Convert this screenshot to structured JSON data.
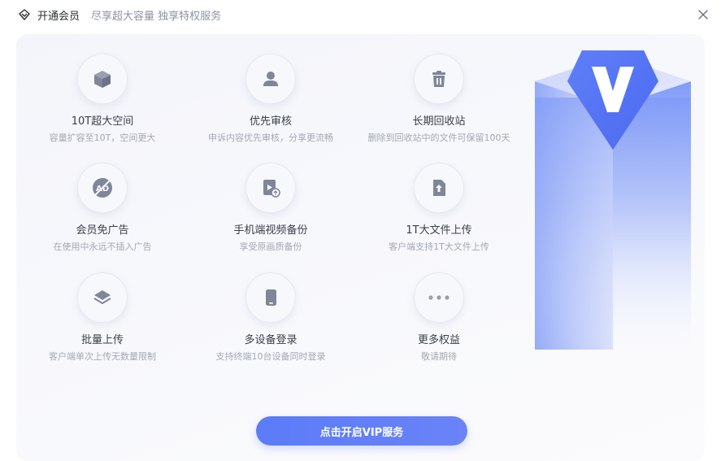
{
  "header": {
    "title": "开通会员",
    "subtitle": "尽享超大容量 独享特权服务"
  },
  "features": [
    {
      "title": "10T超大空间",
      "desc": "容量扩容至10T，空间更大",
      "icon": "cube-icon"
    },
    {
      "title": "优先审核",
      "desc": "申诉内容优先审核，分享更流畅",
      "icon": "user-icon"
    },
    {
      "title": "长期回收站",
      "desc": "删除到回收站中的文件可保留100天",
      "icon": "trash-icon"
    },
    {
      "title": "会员免广告",
      "desc": "在使用中永远不插入广告",
      "icon": "no-ad-icon"
    },
    {
      "title": "手机端视频备份",
      "desc": "享受原画质备份",
      "icon": "video-backup-icon"
    },
    {
      "title": "1T大文件上传",
      "desc": "客户端支持1T大文件上传",
      "icon": "file-upload-icon"
    },
    {
      "title": "批量上传",
      "desc": "客户端单次上传无数量限制",
      "icon": "layers-icon"
    },
    {
      "title": "多设备登录",
      "desc": "支持终端10台设备同时登录",
      "icon": "device-icon"
    },
    {
      "title": "更多权益",
      "desc": "敬请期待",
      "icon": "more-icon"
    }
  ],
  "cta": {
    "label": "点击开启VIP服务"
  },
  "colors": {
    "accent": "#5b7cf8",
    "icon_gray": "#8a90a0",
    "text_dark": "#3a3f4a",
    "text_muted": "#a3a8b5"
  }
}
